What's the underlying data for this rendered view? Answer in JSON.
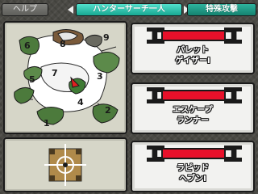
{
  "tabs": {
    "help": "ヘルプ",
    "hunter_search": "ハンターサーチ一人",
    "special_attack": "特殊攻撃"
  },
  "map": {
    "area_labels": [
      "1",
      "2",
      "3",
      "4",
      "5",
      "6",
      "7",
      "8",
      "9"
    ]
  },
  "skills": [
    {
      "name": "バレット\nゲイザーⅠ",
      "color": "#e8102a"
    },
    {
      "name": "エスケープ\nランナー",
      "color": "#e8102a"
    },
    {
      "name": "ラピッド\nヘブンⅠ",
      "color": "#e8102a"
    }
  ],
  "icons": {
    "left_arrow": "arrow-left-icon",
    "right_arrow": "arrow-right-icon",
    "compass": "compass-icon",
    "player_marker": "player-marker-icon"
  }
}
